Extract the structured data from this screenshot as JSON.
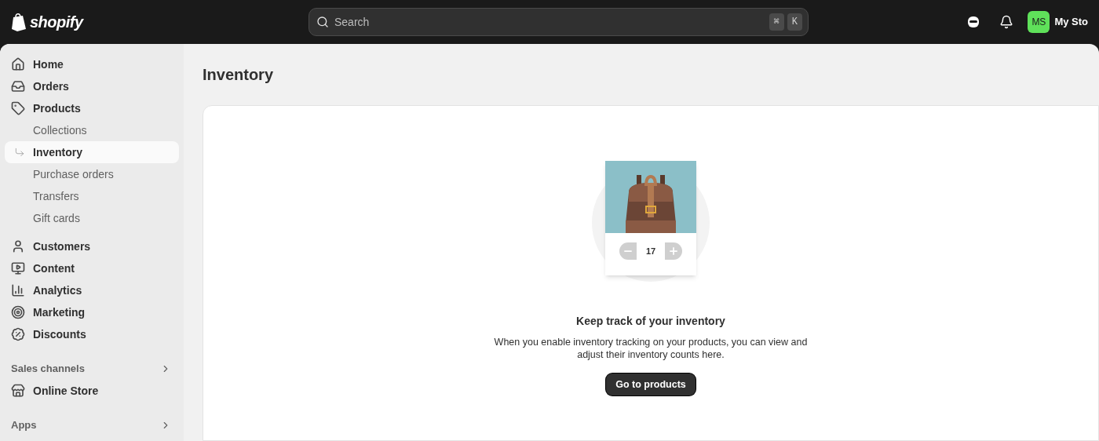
{
  "topbar": {
    "brand": "shopify",
    "search": {
      "placeholder": "Search",
      "shortcut": [
        "⌘",
        "K"
      ]
    },
    "avatar": "MS",
    "store": "My Sto"
  },
  "sidebar": {
    "groups": [
      {
        "items": [
          {
            "label": "Home",
            "kind": "home",
            "selected": false
          },
          {
            "label": "Orders",
            "kind": "orders",
            "selected": false
          },
          {
            "label": "Products",
            "kind": "products",
            "selected": false,
            "children": [
              {
                "label": "Collections",
                "selected": false
              },
              {
                "label": "Inventory",
                "selected": true
              },
              {
                "label": "Purchase orders",
                "selected": false
              },
              {
                "label": "Transfers",
                "selected": false
              },
              {
                "label": "Gift cards",
                "selected": false
              }
            ]
          }
        ]
      },
      {
        "items": [
          {
            "label": "Customers",
            "kind": "customers",
            "selected": false
          },
          {
            "label": "Content",
            "kind": "content",
            "selected": false
          },
          {
            "label": "Analytics",
            "kind": "analytics",
            "selected": false
          },
          {
            "label": "Marketing",
            "kind": "marketing",
            "selected": false
          },
          {
            "label": "Discounts",
            "kind": "discounts",
            "selected": false
          }
        ]
      },
      {
        "heading": "Sales channels",
        "items": [
          {
            "label": "Online Store",
            "kind": "store",
            "selected": false
          }
        ]
      },
      {
        "heading": "Apps"
      }
    ]
  },
  "page": {
    "title": "Inventory",
    "empty_state": {
      "quantity": "17",
      "heading": "Keep track of your inventory",
      "body": "When you enable inventory tracking on your products, you can view and adjust their inventory counts here.",
      "button": "Go to products"
    }
  }
}
